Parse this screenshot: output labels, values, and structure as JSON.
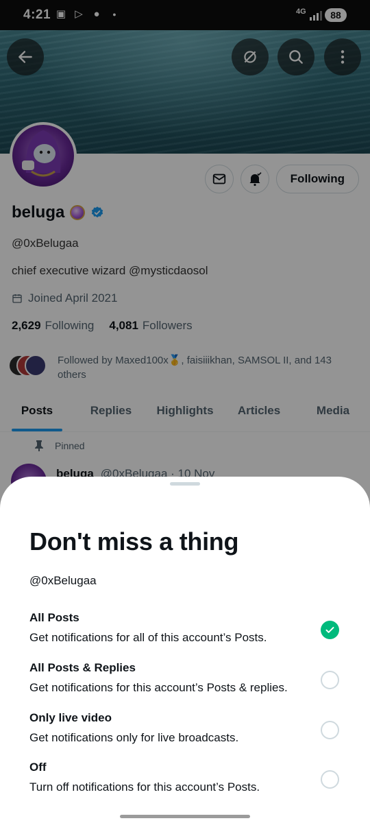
{
  "status_bar": {
    "time": "4:21",
    "network": "4G",
    "battery": "88"
  },
  "profile": {
    "display_name": "beluga",
    "handle": "@0xBelugaa",
    "bio": "chief executive wizard @mysticdaosol",
    "joined": "Joined April 2021",
    "following_count": "2,629",
    "following_label": "Following",
    "followers_count": "4,081",
    "followers_label": "Followers",
    "followed_by": "Followed by Maxed100x🥇, faisiiikhan, SAMSOL II, and 143 others",
    "follow_button": "Following"
  },
  "tabs": [
    "Posts",
    "Replies",
    "Highlights",
    "Articles",
    "Media"
  ],
  "active_tab": "Posts",
  "pinned_post": {
    "pinned_label": "Pinned",
    "author": "beluga",
    "meta": "@0xBelugaa · 10 Nov"
  },
  "sheet": {
    "title": "Don't miss a thing",
    "handle": "@0xBelugaa",
    "options": [
      {
        "label": "All Posts",
        "description": "Get notifications for all of this account’s Posts.",
        "selected": true
      },
      {
        "label": "All Posts & Replies",
        "description": "Get notifications for this account’s Posts & replies.",
        "selected": false
      },
      {
        "label": "Only live video",
        "description": "Get notifications only for live broadcasts.",
        "selected": false
      },
      {
        "label": "Off",
        "description": "Turn off notifications for this account’s Posts.",
        "selected": false
      }
    ]
  },
  "colors": {
    "selected_radio": "#00ba7c",
    "verified_badge": "#1d9bf0",
    "tab_indicator": "#1d9bf0"
  },
  "icons": [
    "back-arrow-icon",
    "grok-icon",
    "search-icon",
    "more-vertical-icon",
    "mail-icon",
    "bell-check-icon",
    "verified-badge-icon",
    "calendar-icon",
    "pin-icon",
    "checkmark-icon"
  ]
}
